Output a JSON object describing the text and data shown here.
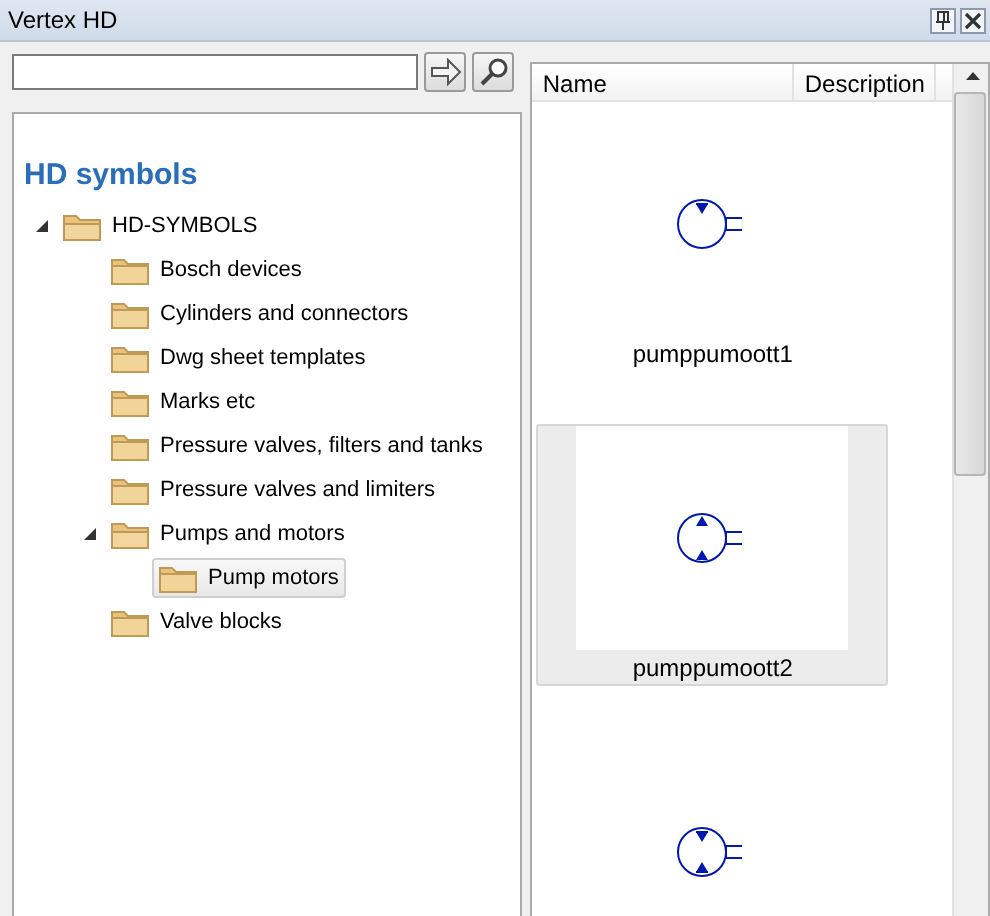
{
  "window": {
    "title": "Vertex HD"
  },
  "tree": {
    "heading": "HD symbols",
    "nodes": [
      {
        "label": "HD-SYMBOLS",
        "expanded": true,
        "selected": false,
        "children": [
          {
            "label": "Bosch devices",
            "selected": false
          },
          {
            "label": "Cylinders and connectors",
            "selected": false
          },
          {
            "label": "Dwg sheet templates",
            "selected": false
          },
          {
            "label": "Marks etc",
            "selected": false
          },
          {
            "label": "Pressure valves, filters and tanks",
            "selected": false
          },
          {
            "label": "Pressure valves and limiters",
            "selected": false
          },
          {
            "label": "Pumps and motors",
            "expanded": true,
            "selected": false,
            "children": [
              {
                "label": "Pump motors",
                "selected": true
              }
            ]
          },
          {
            "label": "Valve blocks",
            "selected": false
          }
        ]
      }
    ]
  },
  "list": {
    "columns": [
      "Name",
      "Description"
    ],
    "items": [
      {
        "kind": "single",
        "label": "pumppumoott1",
        "selected": false
      },
      {
        "kind": "double-out",
        "label": "pumppumoott2",
        "selected": true
      },
      {
        "kind": "double-in",
        "selected": false
      }
    ]
  }
}
